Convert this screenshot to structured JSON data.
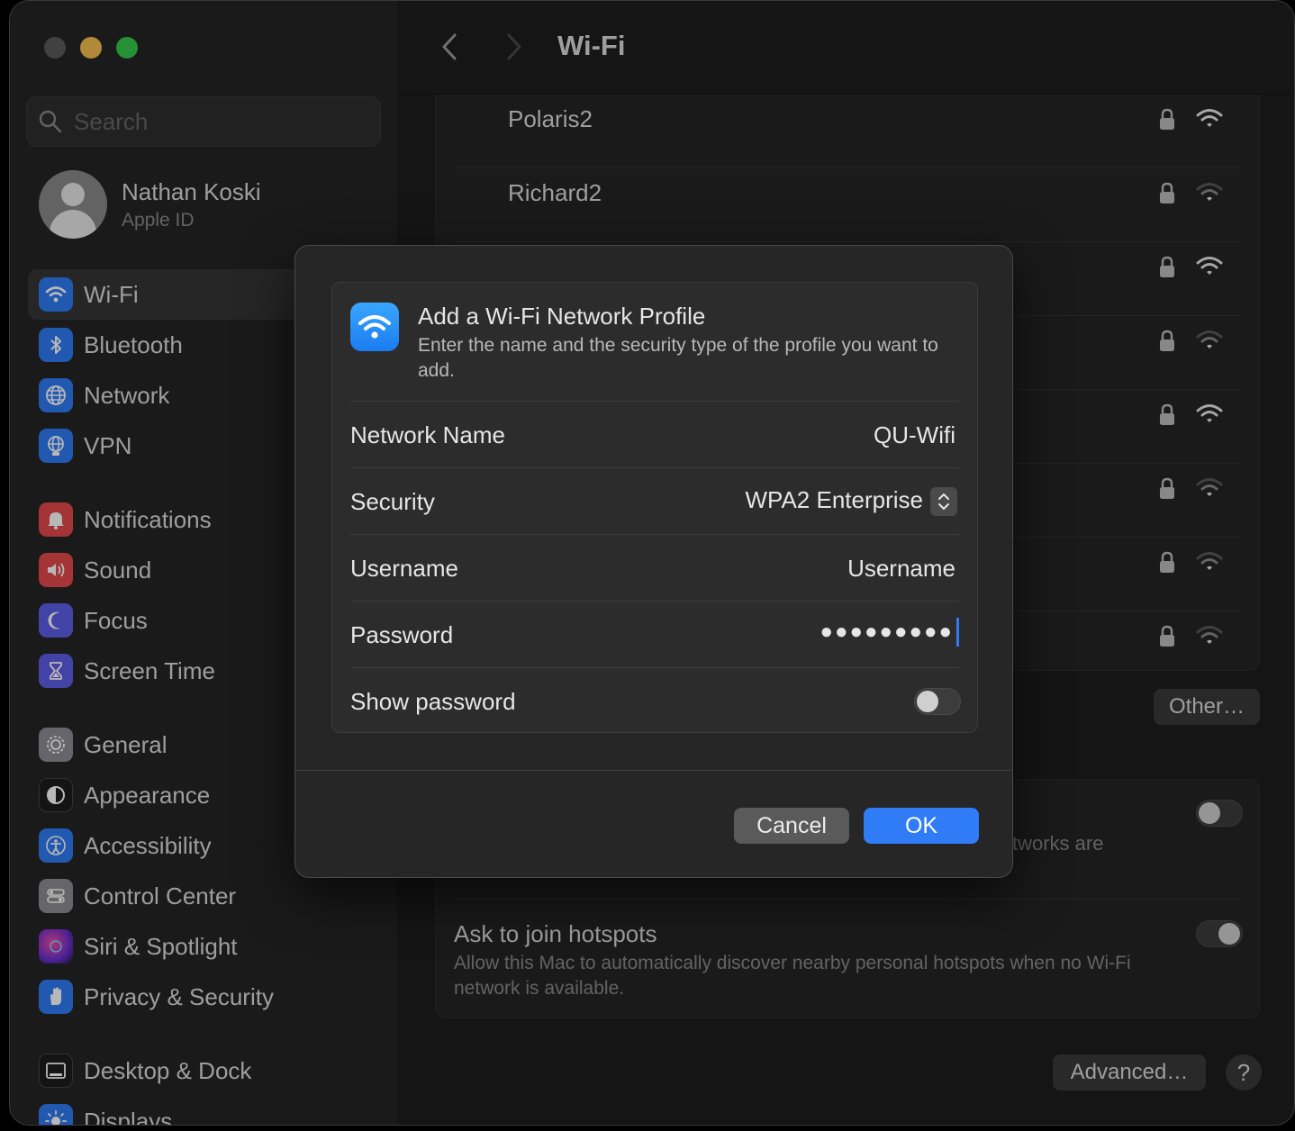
{
  "window": {
    "title": "Wi-Fi"
  },
  "sidebar": {
    "search_placeholder": "Search",
    "account": {
      "name": "Nathan Koski",
      "subtitle": "Apple ID"
    },
    "items": [
      {
        "label": "Wi-Fi",
        "icon": "wifi-icon",
        "color": "#2f7cf6"
      },
      {
        "label": "Bluetooth",
        "icon": "bluetooth-icon",
        "color": "#2f7cf6"
      },
      {
        "label": "Network",
        "icon": "globe-icon",
        "color": "#2f7cf6"
      },
      {
        "label": "VPN",
        "icon": "vpn-globe-icon",
        "color": "#2f7cf6"
      },
      {
        "label": "Notifications",
        "icon": "bell-icon",
        "color": "#e5484d"
      },
      {
        "label": "Sound",
        "icon": "speaker-icon",
        "color": "#e5484d"
      },
      {
        "label": "Focus",
        "icon": "moon-icon",
        "color": "#5e5ce6"
      },
      {
        "label": "Screen Time",
        "icon": "hourglass-icon",
        "color": "#5e5ce6"
      },
      {
        "label": "General",
        "icon": "gear-icon",
        "color": "#8e8e93"
      },
      {
        "label": "Appearance",
        "icon": "appearance-icon",
        "color": "#1c1c1e"
      },
      {
        "label": "Accessibility",
        "icon": "accessibility-icon",
        "color": "#2f7cf6"
      },
      {
        "label": "Control Center",
        "icon": "control-center-icon",
        "color": "#8e8e93"
      },
      {
        "label": "Siri & Spotlight",
        "icon": "siri-icon",
        "color": "#b03aa8"
      },
      {
        "label": "Privacy & Security",
        "icon": "hand-icon",
        "color": "#2f7cf6"
      },
      {
        "label": "Desktop & Dock",
        "icon": "dock-icon",
        "color": "#1c1c1e"
      },
      {
        "label": "Displays",
        "icon": "sun-icon",
        "color": "#2f7cf6"
      }
    ]
  },
  "networks": [
    {
      "name": "Polaris2",
      "signal": "strong"
    },
    {
      "name": "Richard2",
      "signal": "weak"
    },
    {
      "name": "",
      "signal": "strong"
    },
    {
      "name": "",
      "signal": "weak"
    },
    {
      "name": "",
      "signal": "strong"
    },
    {
      "name": "",
      "signal": "weak"
    },
    {
      "name": "",
      "signal": "weak"
    },
    {
      "name": "",
      "signal": "weak"
    }
  ],
  "other_button": "Other…",
  "settings": {
    "partial_desc": "tworks are",
    "hotspot_title": "Ask to join hotspots",
    "hotspot_desc": "Allow this Mac to automatically discover nearby personal hotspots when no Wi-Fi network is available."
  },
  "advanced_button": "Advanced…",
  "help_button": "?",
  "dialog": {
    "title": "Add a Wi-Fi Network Profile",
    "subtitle": "Enter the name and the security type of the profile you want to add.",
    "fields": {
      "network_name_label": "Network Name",
      "network_name_value": "QU-Wifi",
      "security_label": "Security",
      "security_value": "WPA2 Enterprise",
      "username_label": "Username",
      "username_value": "Username",
      "password_label": "Password",
      "password_value": "●●●●●●●●●",
      "show_password_label": "Show password"
    },
    "cancel": "Cancel",
    "ok": "OK"
  }
}
